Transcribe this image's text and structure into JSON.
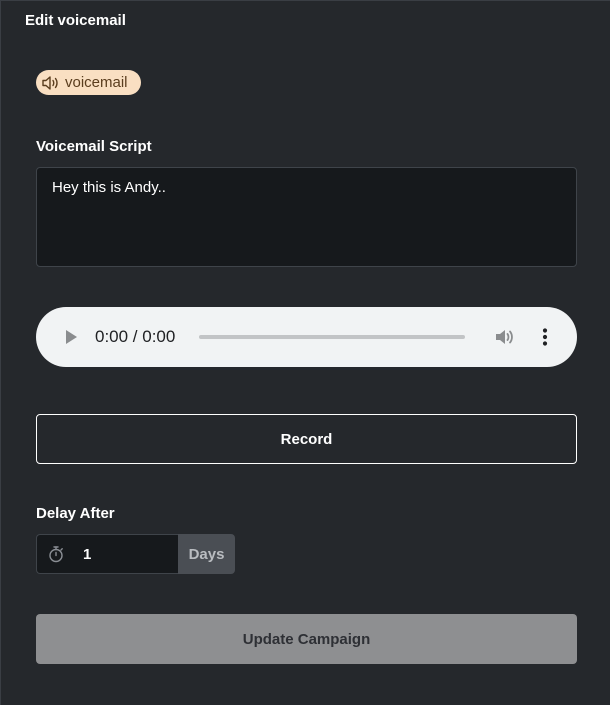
{
  "header": {
    "title": "Edit voicemail"
  },
  "badge": {
    "icon": "speaker-icon",
    "label": "voicemail",
    "background": "#f9dfc2"
  },
  "script": {
    "label": "Voicemail Script",
    "value": "Hey this is Andy.."
  },
  "audio_player": {
    "time": "0:00 / 0:00",
    "play_icon": "play-icon",
    "volume_icon": "volume-icon",
    "menu_icon": "more-vertical-icon"
  },
  "record": {
    "label": "Record"
  },
  "delay": {
    "label": "Delay After",
    "icon": "stopwatch-icon",
    "value": "1",
    "unit": "Days"
  },
  "update": {
    "label": "Update Campaign",
    "background": "#8e8f91"
  }
}
